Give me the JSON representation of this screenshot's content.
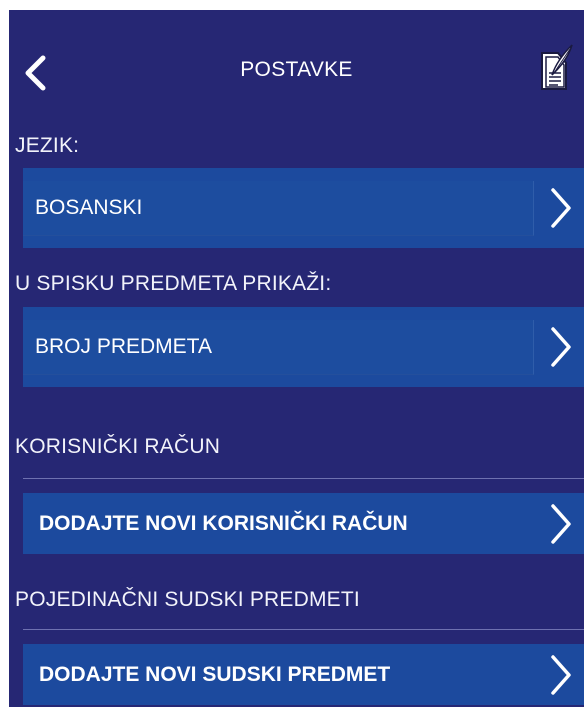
{
  "header": {
    "title": "POSTAVKE"
  },
  "language": {
    "section_label": "JEZIK:",
    "selected_value": "BOSANSKI"
  },
  "list_display": {
    "section_label": "U SPISKU PREDMETA PRIKAŽI:",
    "selected_value": "BROJ PREDMETA"
  },
  "user_account": {
    "section_label": "KORISNIČKI RAČUN",
    "add_label": "DODAJTE NOVI KORISNIČKI RAČUN"
  },
  "court_cases": {
    "section_label": "POJEDINAČNI SUDSKI PREDMETI",
    "add_label": "DODAJTE NOVI SUDSKI PREDMET"
  },
  "icons": {
    "back": "chevron-left-icon",
    "document": "document-quill-icon",
    "row_arrow": "chevron-right-icon"
  },
  "colors": {
    "background": "#262774",
    "row": "#1c4a9e",
    "text": "#ffffff"
  }
}
